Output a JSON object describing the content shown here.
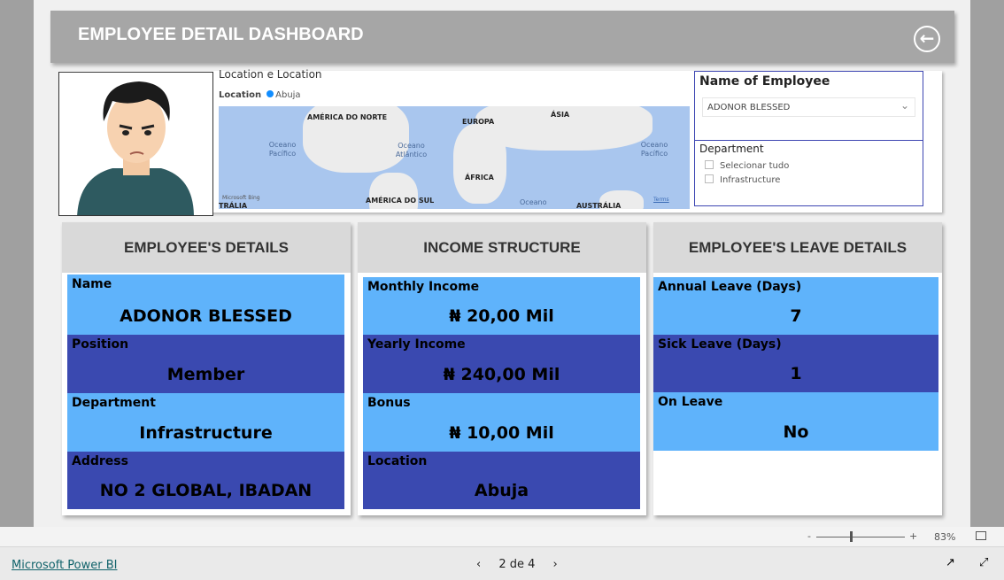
{
  "header": {
    "title": "EMPLOYEE DETAIL DASHBOARD",
    "back_icon": "back-arrow-icon"
  },
  "map": {
    "title": "Location e Location",
    "legend_label": "Location",
    "legend_value": "Abuja",
    "legend_color": "#118dff",
    "labels": {
      "na": "AMÉRICA DO NORTE",
      "eu": "EUROPA",
      "as": "ÁSIA",
      "af": "ÁFRICA",
      "sa": "AMÉRICA DO SUL",
      "au": "AUSTRÁLIA",
      "au2": "TRÁLIA",
      "op1": "Oceano Pacífico",
      "oa": "Oceano Atlântico",
      "op2": "Oceano Pacífico",
      "oc": "Oceano"
    },
    "attribution": "Microsoft Bing",
    "terms": "Terms"
  },
  "slicers": {
    "employee_title": "Name of Employee",
    "employee_value": "ADONOR BLESSED",
    "department_title": "Department",
    "department_options": [
      "Selecionar tudo",
      "Infrastructure"
    ]
  },
  "cards": [
    {
      "title": "EMPLOYEE'S DETAILS",
      "rows": [
        {
          "label": "Name",
          "value": "ADONOR BLESSED"
        },
        {
          "label": "Position",
          "value": "Member"
        },
        {
          "label": "Department",
          "value": "Infrastructure"
        },
        {
          "label": "Address",
          "value": "NO 2 GLOBAL, IBADAN"
        }
      ]
    },
    {
      "title": "INCOME STRUCTURE",
      "rows": [
        {
          "label": "Monthly Income",
          "value": "₦ 20,00 Mil"
        },
        {
          "label": "Yearly Income",
          "value": "₦ 240,00 Mil"
        },
        {
          "label": "Bonus",
          "value": "₦ 10,00 Mil"
        },
        {
          "label": "Location",
          "value": "Abuja"
        }
      ]
    },
    {
      "title": "EMPLOYEE'S LEAVE DETAILS",
      "rows": [
        {
          "label": "Annual Leave (Days)",
          "value": "7"
        },
        {
          "label": "Sick Leave (Days)",
          "value": "1"
        },
        {
          "label": "On Leave",
          "value": "No"
        }
      ]
    }
  ],
  "colors": {
    "light": "#5fb3fb",
    "dark": "#3a49b0",
    "header": "#a6a6a6"
  },
  "zoom": {
    "minus": "-",
    "plus": "+",
    "level": "83%"
  },
  "footer": {
    "brand": "Microsoft Power BI",
    "page": "2 de 4"
  }
}
